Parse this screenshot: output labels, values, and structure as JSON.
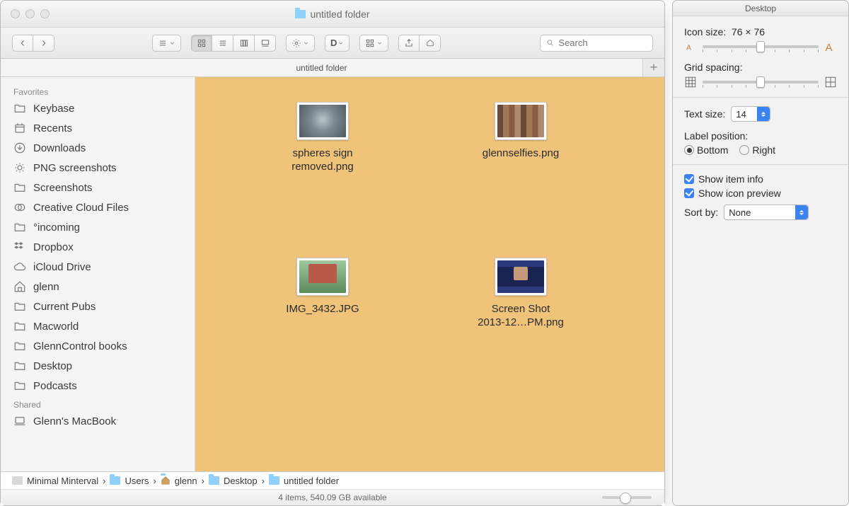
{
  "window": {
    "title": "untitled folder",
    "tab_label": "untitled folder"
  },
  "search": {
    "placeholder": "Search"
  },
  "sidebar": {
    "sections": [
      {
        "header": "Favorites",
        "items": [
          {
            "label": "Keybase",
            "icon": "folder"
          },
          {
            "label": "Recents",
            "icon": "recents"
          },
          {
            "label": "Downloads",
            "icon": "downloads"
          },
          {
            "label": "PNG screenshots",
            "icon": "smart"
          },
          {
            "label": "Screenshots",
            "icon": "folder"
          },
          {
            "label": "Creative Cloud Files",
            "icon": "cc"
          },
          {
            "label": "°incoming",
            "icon": "folder"
          },
          {
            "label": "Dropbox",
            "icon": "dropbox"
          },
          {
            "label": "iCloud Drive",
            "icon": "cloud"
          },
          {
            "label": "glenn",
            "icon": "home"
          },
          {
            "label": "Current Pubs",
            "icon": "folder"
          },
          {
            "label": "Macworld",
            "icon": "folder"
          },
          {
            "label": "GlennControl books",
            "icon": "folder"
          },
          {
            "label": "Desktop",
            "icon": "folder"
          },
          {
            "label": "Podcasts",
            "icon": "folder"
          }
        ]
      },
      {
        "header": "Shared",
        "items": [
          {
            "label": "Glenn's MacBook",
            "icon": "laptop"
          }
        ]
      }
    ]
  },
  "files": [
    {
      "name": "spheres sign removed.png",
      "name_l1": "spheres sign",
      "name_l2": "removed.png",
      "thumb": "t1"
    },
    {
      "name": "glennselfies.png",
      "name_l1": "glennselfies.png",
      "name_l2": "",
      "thumb": "t2"
    },
    {
      "name": "IMG_3432.JPG",
      "name_l1": "IMG_3432.JPG",
      "name_l2": "",
      "thumb": "t3"
    },
    {
      "name": "Screen Shot 2013-12…PM.png",
      "name_l1": "Screen Shot",
      "name_l2": "2013-12…PM.png",
      "thumb": "t4"
    }
  ],
  "path": [
    {
      "label": "Minimal Minterval",
      "icon": "hdd"
    },
    {
      "label": "Users",
      "icon": "folder"
    },
    {
      "label": "glenn",
      "icon": "home"
    },
    {
      "label": "Desktop",
      "icon": "folder"
    },
    {
      "label": "untitled folder",
      "icon": "folder"
    }
  ],
  "status": {
    "text": "4 items, 540.09 GB available"
  },
  "inspector": {
    "title": "Desktop",
    "icon_size_label": "Icon size:",
    "icon_size_value": "76 × 76",
    "grid_spacing_label": "Grid spacing:",
    "text_size_label": "Text size:",
    "text_size_value": "14",
    "label_position_label": "Label position:",
    "label_positions": {
      "bottom": "Bottom",
      "right": "Right",
      "selected": "bottom"
    },
    "show_item_info": {
      "label": "Show item info",
      "checked": true
    },
    "show_icon_preview": {
      "label": "Show icon preview",
      "checked": true
    },
    "sort_by_label": "Sort by:",
    "sort_by_value": "None",
    "icon_slider_pct": 50,
    "grid_slider_pct": 50
  }
}
